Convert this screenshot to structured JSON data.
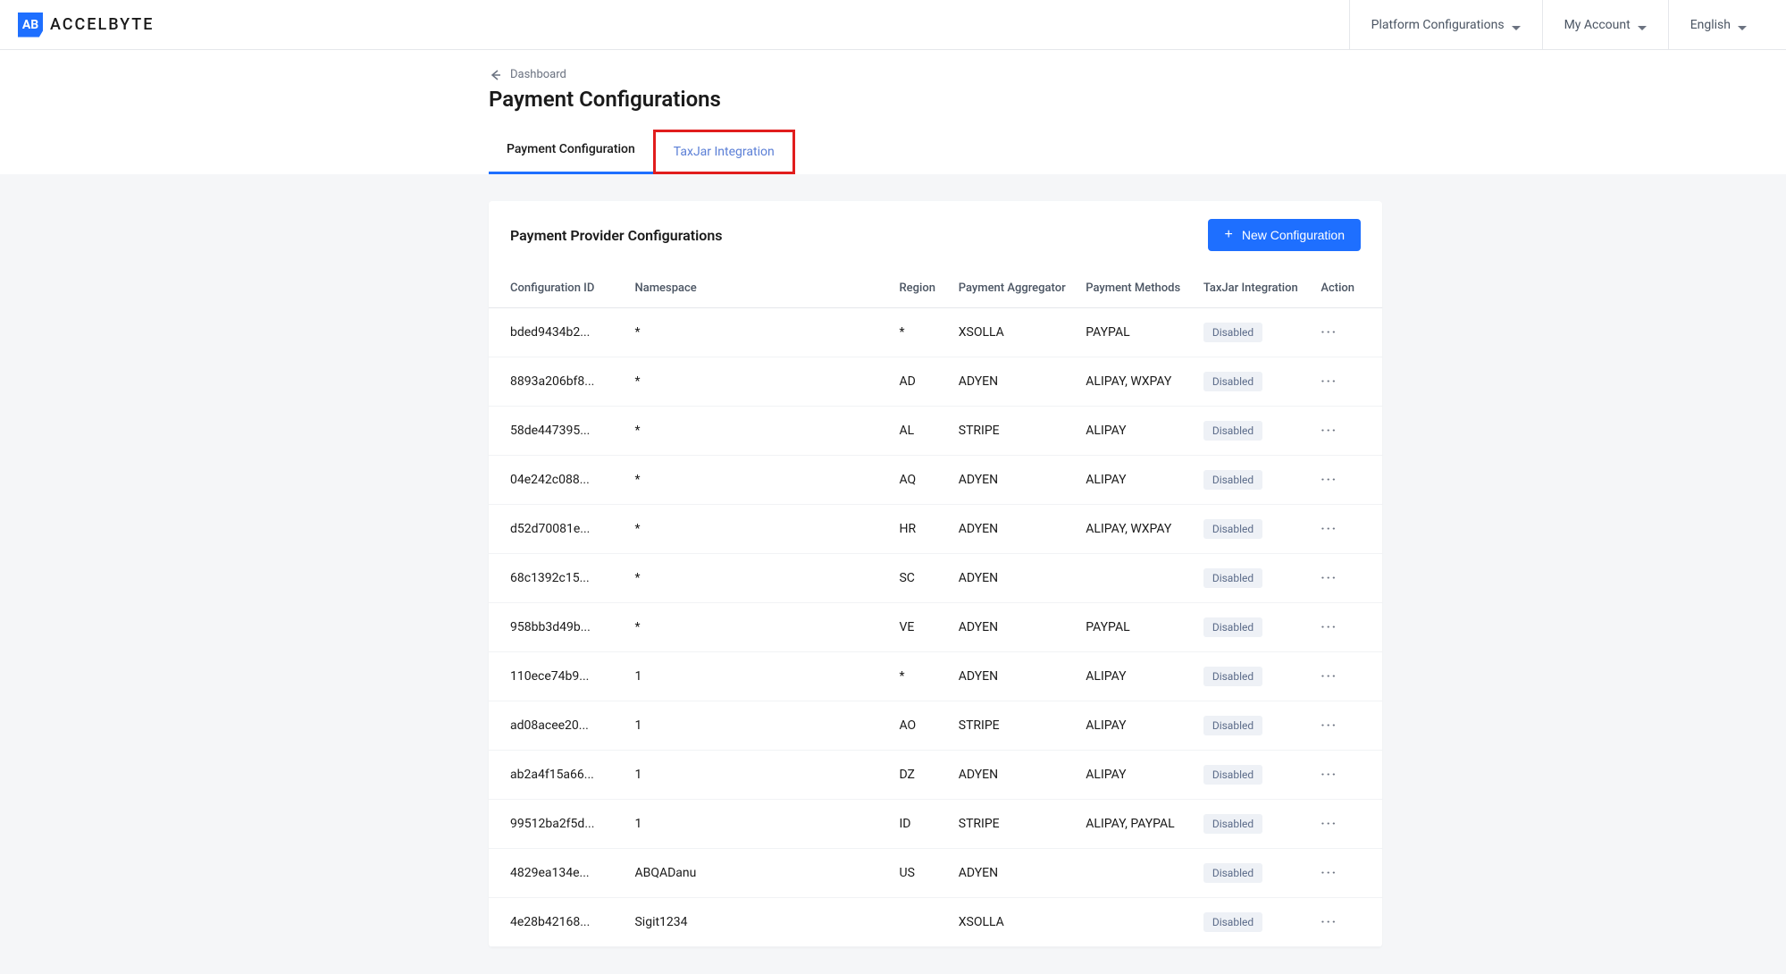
{
  "header": {
    "logo_text": "ACCELBYTE",
    "nav": {
      "platform": "Platform Configurations",
      "account": "My Account",
      "language": "English"
    }
  },
  "breadcrumb": {
    "back_label": "Dashboard"
  },
  "page": {
    "title": "Payment Configurations"
  },
  "tabs": {
    "config": "Payment Configuration",
    "taxjar": "TaxJar Integration"
  },
  "card": {
    "title": "Payment Provider Configurations",
    "new_button": "New Configuration"
  },
  "table": {
    "headers": {
      "config_id": "Configuration ID",
      "namespace": "Namespace",
      "region": "Region",
      "aggregator": "Payment Aggregator",
      "methods": "Payment Methods",
      "taxjar": "TaxJar Integration",
      "action": "Action"
    },
    "rows": [
      {
        "id": "bded9434b2...",
        "ns": "*",
        "region": "*",
        "agg": "XSOLLA",
        "methods": "PAYPAL",
        "tax": "Disabled"
      },
      {
        "id": "8893a206bf8...",
        "ns": "*",
        "region": "AD",
        "agg": "ADYEN",
        "methods": "ALIPAY, WXPAY",
        "tax": "Disabled"
      },
      {
        "id": "58de447395...",
        "ns": "*",
        "region": "AL",
        "agg": "STRIPE",
        "methods": "ALIPAY",
        "tax": "Disabled"
      },
      {
        "id": "04e242c088...",
        "ns": "*",
        "region": "AQ",
        "agg": "ADYEN",
        "methods": "ALIPAY",
        "tax": "Disabled"
      },
      {
        "id": "d52d70081e...",
        "ns": "*",
        "region": "HR",
        "agg": "ADYEN",
        "methods": "ALIPAY, WXPAY",
        "tax": "Disabled"
      },
      {
        "id": "68c1392c15...",
        "ns": "*",
        "region": "SC",
        "agg": "ADYEN",
        "methods": "",
        "tax": "Disabled"
      },
      {
        "id": "958bb3d49b...",
        "ns": "*",
        "region": "VE",
        "agg": "ADYEN",
        "methods": "PAYPAL",
        "tax": "Disabled"
      },
      {
        "id": "110ece74b9...",
        "ns": "1",
        "region": "*",
        "agg": "ADYEN",
        "methods": "ALIPAY",
        "tax": "Disabled"
      },
      {
        "id": "ad08acee20...",
        "ns": "1",
        "region": "AO",
        "agg": "STRIPE",
        "methods": "ALIPAY",
        "tax": "Disabled"
      },
      {
        "id": "ab2a4f15a66...",
        "ns": "1",
        "region": "DZ",
        "agg": "ADYEN",
        "methods": "ALIPAY",
        "tax": "Disabled"
      },
      {
        "id": "99512ba2f5d...",
        "ns": "1",
        "region": "ID",
        "agg": "STRIPE",
        "methods": "ALIPAY, PAYPAL",
        "tax": "Disabled"
      },
      {
        "id": "4829ea134e...",
        "ns": "ABQADanu",
        "region": "US",
        "agg": "ADYEN",
        "methods": "",
        "tax": "Disabled"
      },
      {
        "id": "4e28b42168...",
        "ns": "Sigit1234",
        "region": "",
        "agg": "XSOLLA",
        "methods": "",
        "tax": "Disabled"
      }
    ]
  }
}
